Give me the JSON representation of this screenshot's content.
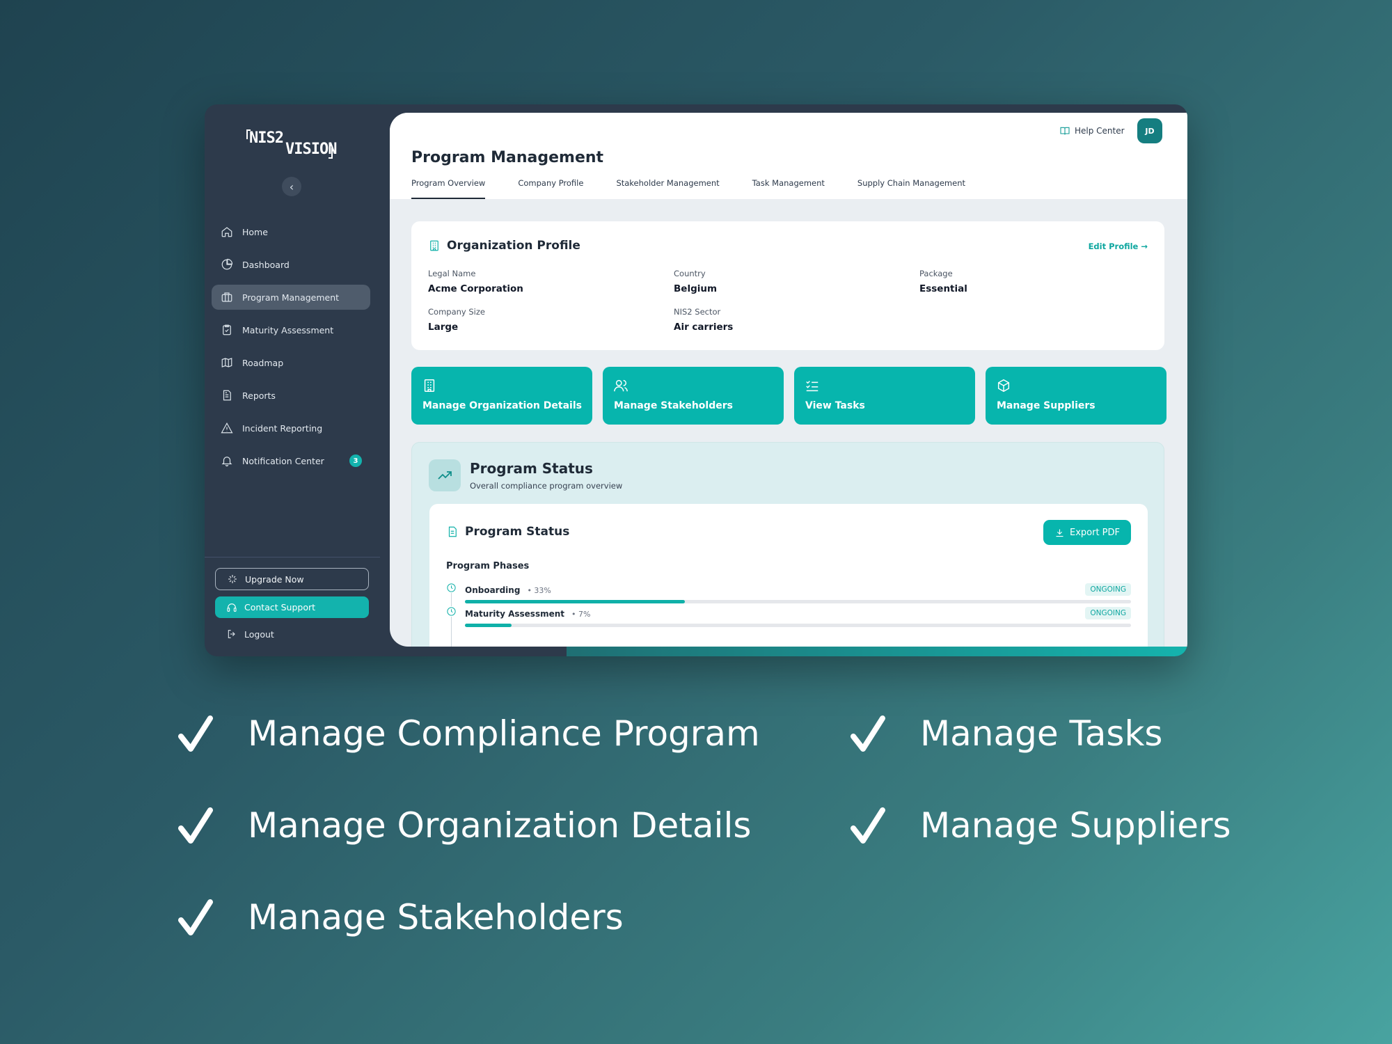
{
  "app": {
    "logo": {
      "part1": "NIS2",
      "part2": "VISION"
    },
    "sidebar": {
      "collapse_glyph": "‹",
      "items": [
        {
          "label": "Home",
          "icon": "home-icon"
        },
        {
          "label": "Dashboard",
          "icon": "pie-chart-icon"
        },
        {
          "label": "Program Management",
          "icon": "briefcase-icon",
          "active": true
        },
        {
          "label": "Maturity Assessment",
          "icon": "clipboard-check-icon"
        },
        {
          "label": "Roadmap",
          "icon": "map-icon"
        },
        {
          "label": "Reports",
          "icon": "document-icon"
        },
        {
          "label": "Incident Reporting",
          "icon": "warning-icon"
        },
        {
          "label": "Notification Center",
          "icon": "bell-icon",
          "badge": "3"
        }
      ],
      "upgrade_label": "Upgrade Now",
      "support_label": "Contact Support",
      "logout_label": "Logout"
    },
    "header": {
      "help_label": "Help Center",
      "avatar_initials": "JD",
      "page_title": "Program Management",
      "tabs": [
        {
          "label": "Program Overview",
          "active": true
        },
        {
          "label": "Company Profile"
        },
        {
          "label": "Stakeholder Management"
        },
        {
          "label": "Task Management"
        },
        {
          "label": "Supply Chain Management"
        }
      ]
    },
    "org_profile": {
      "title": "Organization Profile",
      "edit_label": "Edit Profile →",
      "fields": {
        "legal_name": {
          "label": "Legal Name",
          "value": "Acme Corporation"
        },
        "country": {
          "label": "Country",
          "value": "Belgium"
        },
        "package": {
          "label": "Package",
          "value": "Essential"
        },
        "company_size": {
          "label": "Company Size",
          "value": "Large"
        },
        "sector": {
          "label": "NIS2 Sector",
          "value": "Air carriers"
        }
      }
    },
    "actions": [
      {
        "label": "Manage Organization Details",
        "icon": "building-icon"
      },
      {
        "label": "Manage Stakeholders",
        "icon": "users-icon"
      },
      {
        "label": "View Tasks",
        "icon": "checklist-icon"
      },
      {
        "label": "Manage Suppliers",
        "icon": "package-icon"
      }
    ],
    "program_status": {
      "title": "Program Status",
      "subtitle": "Overall compliance program overview",
      "card_title": "Program Status",
      "export_label": "Export PDF",
      "phases_title": "Program Phases",
      "phases": [
        {
          "name": "Onboarding",
          "percent_label": "• 33%",
          "progress": 0.33,
          "state": "ONGOING"
        },
        {
          "name": "Maturity Assessment",
          "percent_label": "• 7%",
          "progress": 0.07,
          "state": "ONGOING"
        }
      ]
    },
    "colors": {
      "accent": "#07b5ad",
      "sidebar_bg": "#2d3a4b",
      "background_gradient_start": "#1f4350",
      "background_gradient_end": "#48a3a0"
    }
  },
  "features": [
    "Manage Compliance Program",
    "Manage Tasks",
    "Manage Organization Details",
    "Manage Suppliers",
    "Manage Stakeholders"
  ]
}
